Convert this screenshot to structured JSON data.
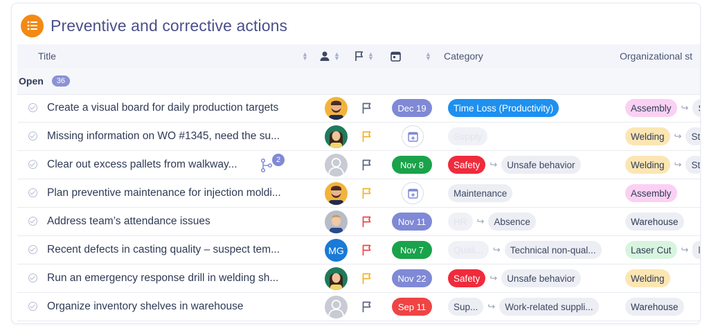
{
  "page": {
    "title": "Preventive and corrective actions",
    "icon": "list-icon",
    "accent": "#f28a14"
  },
  "columns": {
    "title": "Title",
    "assignee_icon": "person-icon",
    "priority_icon": "flag-icon",
    "due_icon": "calendar-icon",
    "category": "Category",
    "org": "Organizational st"
  },
  "group": {
    "label": "Open",
    "count": "36"
  },
  "rows": [
    {
      "title": "Create a visual board for daily production targets",
      "avatar": "face-beard",
      "flag": "gray",
      "due": "Dec 19",
      "due_color": "blue",
      "cat": [
        {
          "text": "Time Loss (Productivity)",
          "style": "blue"
        }
      ],
      "org": [
        {
          "text": "Assembly",
          "style": "pink"
        },
        {
          "text": "S",
          "style": "stub"
        }
      ]
    },
    {
      "title": "Missing information on WO #1345, need the su...",
      "avatar": "face-green",
      "flag": "yellow",
      "due": "",
      "due_color": "none",
      "cat": [
        {
          "text": "Supply",
          "style": "faint"
        }
      ],
      "org": [
        {
          "text": "Welding",
          "style": "yellow"
        },
        {
          "text": "St",
          "style": "stub"
        }
      ]
    },
    {
      "title": "Clear out excess pallets from walkway...",
      "subtasks": "2",
      "avatar": "gray",
      "flag": "gray",
      "due": "Nov 8",
      "due_color": "green",
      "cat": [
        {
          "text": "Safety",
          "style": "red"
        },
        {
          "text": "Unsafe behavior",
          "style": "gray"
        }
      ],
      "org": [
        {
          "text": "Welding",
          "style": "yellow"
        },
        {
          "text": "St",
          "style": "stub"
        }
      ]
    },
    {
      "title": "Plan preventive maintenance for injection moldi...",
      "avatar": "face-beard",
      "flag": "yellow",
      "due": "",
      "due_color": "none",
      "cat": [
        {
          "text": "Maintenance",
          "style": "gray"
        }
      ],
      "org": [
        {
          "text": "Assembly",
          "style": "pink"
        }
      ]
    },
    {
      "title": "Address team’s attendance issues",
      "avatar": "face-light",
      "flag": "red",
      "due": "Nov 11",
      "due_color": "blue",
      "cat": [
        {
          "text": "HR",
          "style": "faint"
        },
        {
          "text": "Absence",
          "style": "gray"
        }
      ],
      "org": [
        {
          "text": "Warehouse",
          "style": "gray"
        }
      ]
    },
    {
      "title": "Recent defects in casting quality – suspect tem...",
      "avatar": "initials",
      "initials": "MG",
      "flag": "red",
      "due": "Nov 7",
      "due_color": "green",
      "cat": [
        {
          "text": "Quali...",
          "style": "faint"
        },
        {
          "text": "Technical non-qual...",
          "style": "gray"
        }
      ],
      "org": [
        {
          "text": "Laser Cut",
          "style": "green"
        },
        {
          "text": "l",
          "style": "stub"
        }
      ]
    },
    {
      "title": "Run an emergency response drill in welding sh...",
      "avatar": "face-green",
      "flag": "yellow",
      "due": "Nov 22",
      "due_color": "blue",
      "cat": [
        {
          "text": "Safety",
          "style": "red"
        },
        {
          "text": "Unsafe behavior",
          "style": "gray"
        }
      ],
      "org": [
        {
          "text": "Welding",
          "style": "yellow"
        }
      ]
    },
    {
      "title": "Organize inventory shelves in warehouse",
      "avatar": "gray",
      "flag": "gray",
      "due": "Sep 11",
      "due_color": "red",
      "cat": [
        {
          "text": "Sup...",
          "style": "gray"
        },
        {
          "text": "Work-related suppli...",
          "style": "gray"
        }
      ],
      "org": [
        {
          "text": "Warehouse",
          "style": "gray"
        }
      ]
    }
  ],
  "colors": {
    "flag_gray": "#5b6480",
    "flag_yellow": "#f0b429",
    "flag_red": "#ef4444"
  }
}
